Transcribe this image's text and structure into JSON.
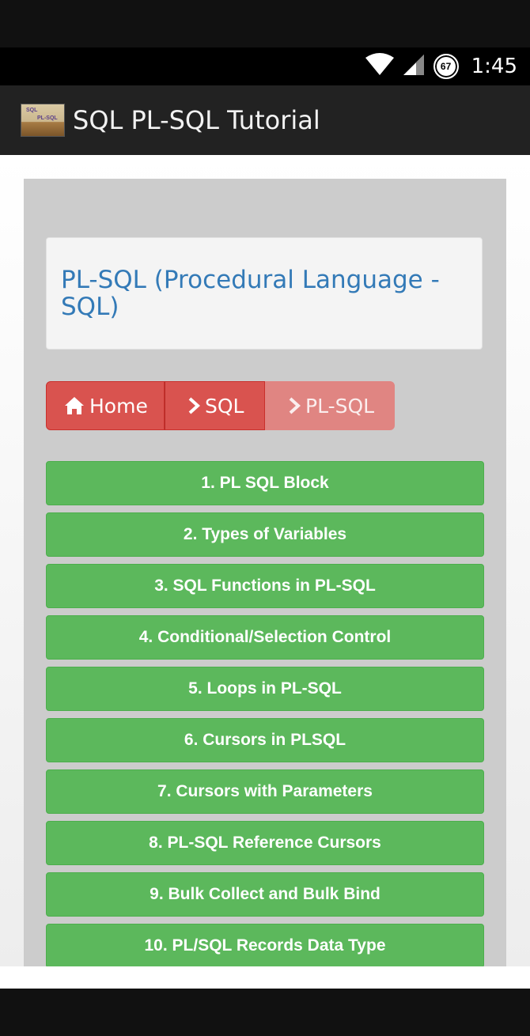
{
  "status_bar": {
    "time": "1:45",
    "battery_level": "67",
    "icons": [
      "wifi-icon",
      "signal-icon",
      "battery-icon"
    ]
  },
  "app": {
    "title": "SQL PL-SQL Tutorial",
    "logo_text_top": "SQL",
    "logo_text_bottom": "PL-SQL"
  },
  "page": {
    "title": "PL-SQL (Procedural Language - SQL)"
  },
  "breadcrumb": {
    "home": "Home",
    "sql": "SQL",
    "current": "PL-SQL"
  },
  "topics": [
    "1. PL SQL Block",
    "2. Types of Variables",
    "3. SQL Functions in PL-SQL",
    "4. Conditional/Selection Control",
    "5. Loops in PL-SQL",
    "6. Cursors in PLSQL",
    "7. Cursors with Parameters",
    "8. PL-SQL Reference Cursors",
    "9. Bulk Collect and Bulk Bind",
    "10. PL/SQL Records Data Type"
  ],
  "colors": {
    "primary_blue": "#337ab7",
    "danger_red": "#d9534f",
    "success_green": "#5cb85c"
  }
}
